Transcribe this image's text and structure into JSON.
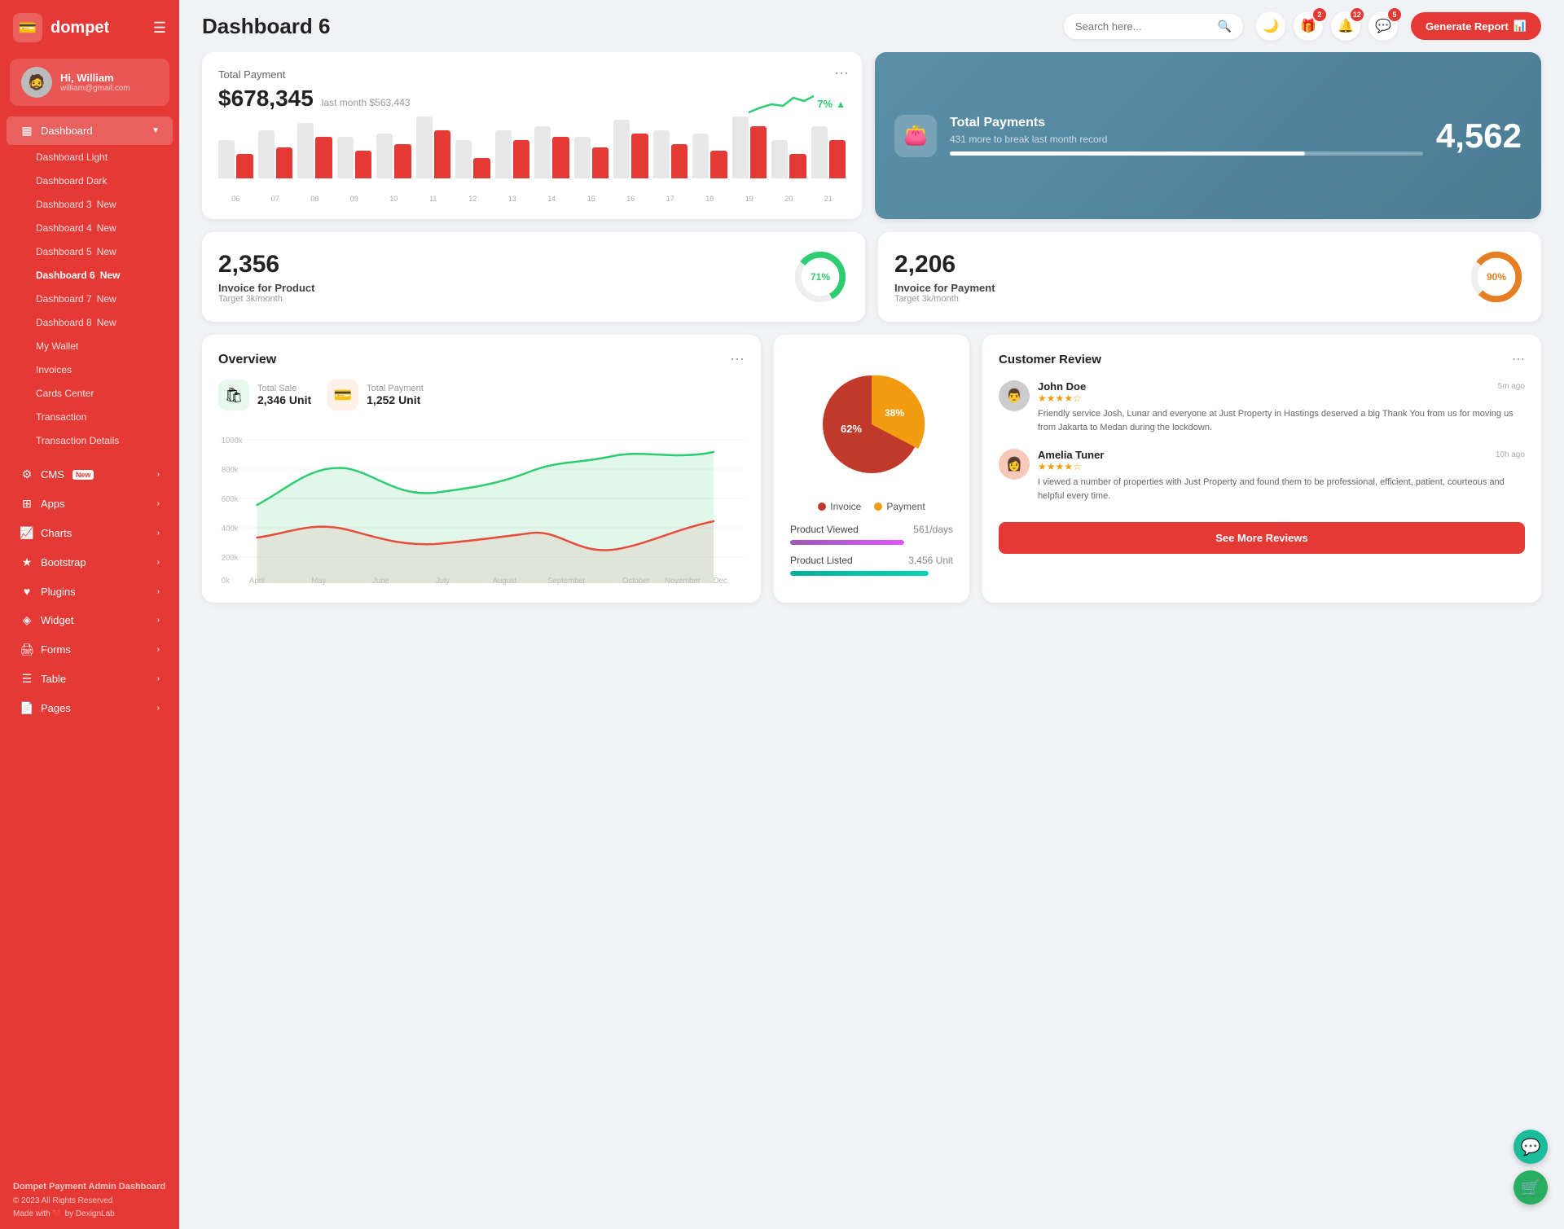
{
  "brand": {
    "name": "dompet",
    "logo_icon": "💳"
  },
  "user": {
    "greeting": "Hi, William",
    "email": "william@gmail.com",
    "avatar": "🧔"
  },
  "sidebar": {
    "dashboard_label": "Dashboard",
    "items": [
      {
        "label": "Dashboard Light",
        "key": "dashboard-light"
      },
      {
        "label": "Dashboard Dark",
        "key": "dashboard-dark"
      },
      {
        "label": "Dashboard 3",
        "key": "dashboard-3",
        "badge": "New"
      },
      {
        "label": "Dashboard 4",
        "key": "dashboard-4",
        "badge": "New"
      },
      {
        "label": "Dashboard 5",
        "key": "dashboard-5",
        "badge": "New"
      },
      {
        "label": "Dashboard 6",
        "key": "dashboard-6",
        "badge": "New",
        "active": true
      },
      {
        "label": "Dashboard 7",
        "key": "dashboard-7",
        "badge": "New"
      },
      {
        "label": "Dashboard 8",
        "key": "dashboard-8",
        "badge": "New"
      },
      {
        "label": "My Wallet",
        "key": "my-wallet"
      },
      {
        "label": "Invoices",
        "key": "invoices"
      },
      {
        "label": "Cards Center",
        "key": "cards-center"
      },
      {
        "label": "Transaction",
        "key": "transaction"
      },
      {
        "label": "Transaction Details",
        "key": "transaction-details"
      }
    ],
    "menu": [
      {
        "label": "CMS",
        "key": "cms",
        "icon": "⚙️",
        "badge": "New",
        "has_children": true
      },
      {
        "label": "Apps",
        "key": "apps",
        "icon": "📱",
        "has_children": true
      },
      {
        "label": "Charts",
        "key": "charts",
        "icon": "📊",
        "has_children": true
      },
      {
        "label": "Bootstrap",
        "key": "bootstrap",
        "icon": "⭐",
        "has_children": true
      },
      {
        "label": "Plugins",
        "key": "plugins",
        "icon": "❤️",
        "has_children": true
      },
      {
        "label": "Widget",
        "key": "widget",
        "icon": "💠",
        "has_children": true
      },
      {
        "label": "Forms",
        "key": "forms",
        "icon": "🖨️",
        "has_children": true
      },
      {
        "label": "Table",
        "key": "table",
        "icon": "☰",
        "has_children": true
      },
      {
        "label": "Pages",
        "key": "pages",
        "icon": "📄",
        "has_children": true
      }
    ],
    "footer": {
      "brand": "Dompet Payment Admin Dashboard",
      "copy": "© 2023 All Rights Reserved",
      "made_with": "Made with ❤️ by DexignLab"
    }
  },
  "header": {
    "title": "Dashboard 6",
    "search_placeholder": "Search here...",
    "generate_btn": "Generate Report",
    "notif_badges": {
      "gift": 2,
      "bell": 12,
      "message": 5
    }
  },
  "total_payment": {
    "label": "Total Payment",
    "amount": "$678,345",
    "last_month": "last month $563,443",
    "trend_pct": "7%",
    "bars": [
      {
        "light": 55,
        "red": 35
      },
      {
        "light": 70,
        "red": 45
      },
      {
        "light": 80,
        "red": 60
      },
      {
        "light": 60,
        "red": 40
      },
      {
        "light": 65,
        "red": 50
      },
      {
        "light": 90,
        "red": 70
      },
      {
        "light": 55,
        "red": 30
      },
      {
        "light": 70,
        "red": 55
      },
      {
        "light": 75,
        "red": 60
      },
      {
        "light": 60,
        "red": 45
      },
      {
        "light": 85,
        "red": 65
      },
      {
        "light": 70,
        "red": 50
      },
      {
        "light": 65,
        "red": 40
      },
      {
        "light": 90,
        "red": 75
      },
      {
        "light": 55,
        "red": 35
      },
      {
        "light": 75,
        "red": 55
      }
    ],
    "x_labels": [
      "06",
      "07",
      "08",
      "09",
      "10",
      "11",
      "12",
      "13",
      "14",
      "15",
      "16",
      "17",
      "18",
      "19",
      "20",
      "21"
    ]
  },
  "total_payments_blue": {
    "label": "Total Payments",
    "sub": "431 more to break last month record",
    "number": "4,562",
    "progress_pct": 75
  },
  "invoice_product": {
    "number": "2,356",
    "label": "Invoice for Product",
    "target": "Target 3k/month",
    "pct": 71,
    "color": "#2ecc71"
  },
  "invoice_payment": {
    "number": "2,206",
    "label": "Invoice for Payment",
    "target": "Target 3k/month",
    "pct": 90,
    "color": "#e67e22"
  },
  "overview": {
    "title": "Overview",
    "total_sale_label": "Total Sale",
    "total_sale_value": "2,346 Unit",
    "total_payment_label": "Total Payment",
    "total_payment_value": "1,252 Unit",
    "months": [
      "April",
      "May",
      "June",
      "July",
      "August",
      "September",
      "October",
      "November",
      "Dec."
    ],
    "y_labels": [
      "1000k",
      "800k",
      "600k",
      "400k",
      "200k",
      "0k"
    ]
  },
  "pie_chart": {
    "invoice_pct": 62,
    "payment_pct": 38,
    "invoice_label": "Invoice",
    "payment_label": "Payment",
    "invoice_color": "#c0392b",
    "payment_color": "#f39c12"
  },
  "products": {
    "viewed_label": "Product Viewed",
    "viewed_value": "561/days",
    "listed_label": "Product Listed",
    "listed_value": "3,456 Unit"
  },
  "customer_review": {
    "title": "Customer Review",
    "btn_label": "See More Reviews",
    "reviews": [
      {
        "name": "John Doe",
        "stars": 4,
        "time": "5m ago",
        "text": "Friendly service Josh, Lunar and everyone at Just Property in Hastings deserved a big Thank You from us for moving us from Jakarta to Medan during the lockdown.",
        "avatar": "👨"
      },
      {
        "name": "Amelia Tuner",
        "stars": 4,
        "time": "10h ago",
        "text": "I viewed a number of properties with Just Property and found them to be professional, efficient, patient, courteous and helpful every time.",
        "avatar": "👩"
      }
    ]
  },
  "floating_btns": [
    {
      "icon": "💬",
      "color": "teal"
    },
    {
      "icon": "🛒",
      "color": "green"
    }
  ]
}
